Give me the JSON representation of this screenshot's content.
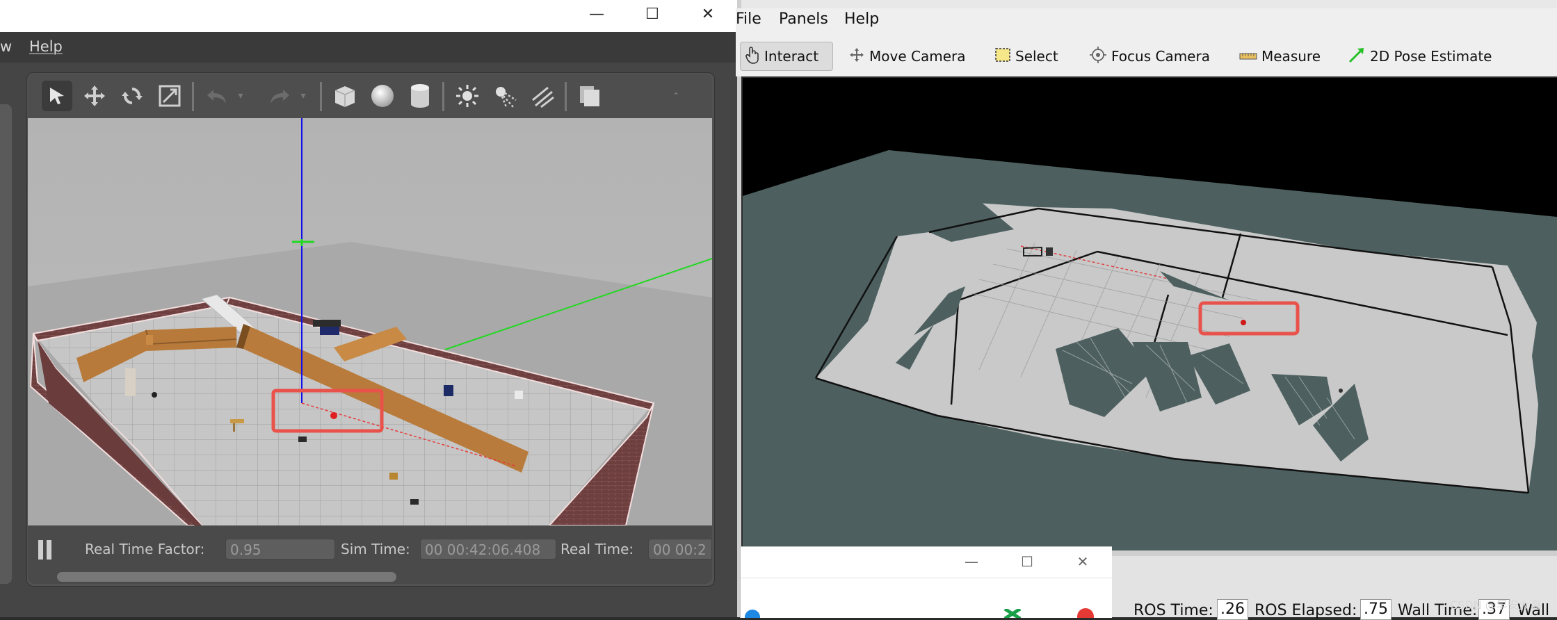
{
  "gazebo": {
    "menu": {
      "partial": "w",
      "help": "Help"
    },
    "controls": {
      "minimize": "—",
      "maximize": "☐",
      "close": "✕"
    },
    "bottom": {
      "pause_icon": "pause-icon",
      "rtf_label": "Real Time Factor:",
      "rtf_value": "0.95",
      "sim_label": "Sim Time:",
      "sim_value": "00 00:42:06.408",
      "real_label": "Real Time:",
      "real_value": "00 00:2"
    }
  },
  "rviz": {
    "menu": {
      "file": "File",
      "panels": "Panels",
      "help": "Help"
    },
    "tools": {
      "interact": "Interact",
      "move_camera": "Move Camera",
      "select": "Select",
      "focus_camera": "Focus Camera",
      "measure": "Measure",
      "pose_estimate": "2D Pose Estimate"
    },
    "status": {
      "ros_time_label": "ROS Time:",
      "ros_time_value": ".26",
      "ros_elapsed_label": "ROS Elapsed:",
      "ros_elapsed_value": ".75",
      "wall_time_label": "Wall Time:",
      "wall_time_value": ".37",
      "wall_label_partial": "Wall"
    }
  },
  "popup": {
    "minimize": "—",
    "maximize": "☐",
    "close": "✕"
  },
  "watermark": "CSDN @早安大海",
  "colors": {
    "highlight": "#e8524a",
    "map_bg": "#4d605f",
    "grid_floor": "#bdbdbd"
  }
}
